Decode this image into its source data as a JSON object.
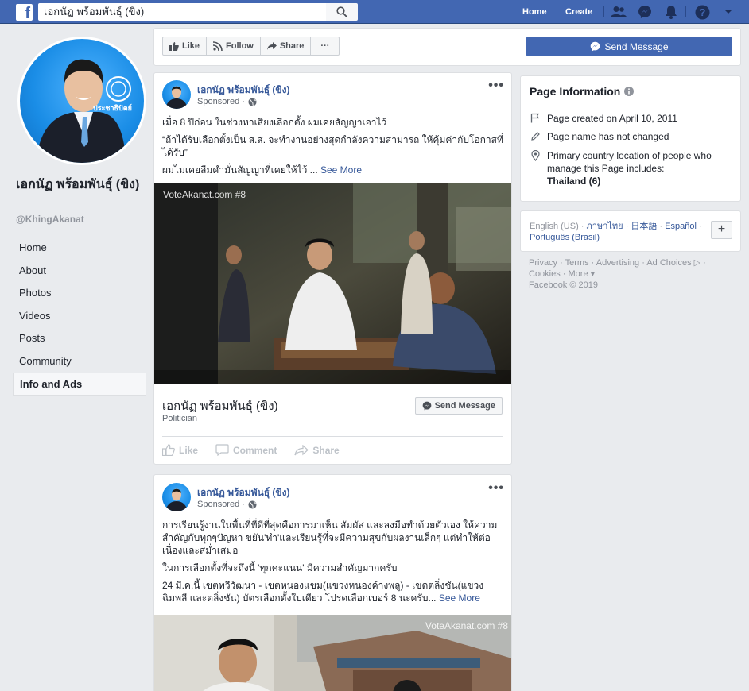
{
  "topbar": {
    "search_value": "เอกนัฏ พร้อมพันธุ์ (ขิง)",
    "home": "Home",
    "create": "Create"
  },
  "profile": {
    "name": "เอกนัฏ พร้อมพันธุ์ (ขิง)",
    "handle": "@KhingAkanat",
    "badge_text": "ประชาธิปัตย์"
  },
  "left_nav": {
    "items": [
      {
        "label": "Home"
      },
      {
        "label": "About"
      },
      {
        "label": "Photos"
      },
      {
        "label": "Videos"
      },
      {
        "label": "Posts"
      },
      {
        "label": "Community"
      },
      {
        "label": "Info and Ads"
      }
    ],
    "active": "Info and Ads"
  },
  "action_bar": {
    "like": "Like",
    "follow": "Follow",
    "share": "Share",
    "more": "···",
    "send_message": "Send Message"
  },
  "post1": {
    "author": "เอกนัฏ พร้อมพันธุ์ (ขิง)",
    "sponsored": "Sponsored ·",
    "text1": "เมื่อ 8 ปีก่อน ในช่วงหาเสียงเลือกตั้ง ผมเคยสัญญาเอาไว้",
    "text2": "“ถ้าได้รับเลือกตั้งเป็น ส.ส. จะทำงานอย่างสุดกำลังความสามารถ ให้คุ้มค่ากับโอกาสที่ได้รับ”",
    "text3": "ผมไม่เคยลืมคำมั่นสัญญาที่เคยให้ไว้ ...",
    "see_more": "See More",
    "watermark": "VoteAkanat.com #8",
    "attach_title": "เอกนัฏ พร้อมพันธุ์ (ขิง)",
    "attach_sub": "Politician",
    "send_message": "Send Message",
    "like": "Like",
    "comment": "Comment",
    "share": "Share"
  },
  "post2": {
    "author": "เอกนัฏ พร้อมพันธุ์ (ขิง)",
    "sponsored": "Sponsored ·",
    "text1": "การเรียนรู้งานในพื้นที่ที่ดีที่สุดคือการมาเห็น สัมผัส และลงมือทำด้วยตัวเอง ให้ความสำคัญกับทุกๆปัญหา ขยัน'ทำ'และเรียนรู้ที่จะมีความสุขกับผลงานเล็กๆ แต่ทำให้ต่อเนื่องและสม่ำเสมอ",
    "text2": "ในการเลือกตั้งที่จะถึงนี้ 'ทุกคะแนน' มีความสำคัญมากครับ",
    "text3": "24 มี.ค.นี้ เขตทวีวัฒนา - เขตหนองแขม(แขวงหนองค้างพลู) - เขตตลิ่งชัน(แขวงฉิมพลี และตลิ่งชัน) บัตรเลือกตั้งใบเดียว โปรดเลือกเบอร์ 8 นะครับ...",
    "see_more": "See More",
    "watermark": "VoteAkanat.com #8"
  },
  "page_info": {
    "title": "Page Information",
    "created": "Page created on April 10, 2011",
    "name_changed": "Page name has not changed",
    "country_label": "Primary country location of people who manage this Page includes:",
    "country_value": "Thailand (6)"
  },
  "languages": {
    "current": "English (US) ·",
    "lang1": "ภาษาไทย",
    "sep1": "·",
    "lang2": "日本語",
    "sep2": "·",
    "lang3": "Español",
    "sep3": "·",
    "lang4": "Português (Brasil)",
    "add": "+"
  },
  "footer": {
    "line1": "Privacy · Terms · Advertising · Ad Choices ▷ ·",
    "line2": "Cookies · More ▾",
    "line3": "Facebook © 2019"
  },
  "colors": {
    "brand": "#4267b2",
    "link": "#365899",
    "bg": "#e9ebee"
  }
}
